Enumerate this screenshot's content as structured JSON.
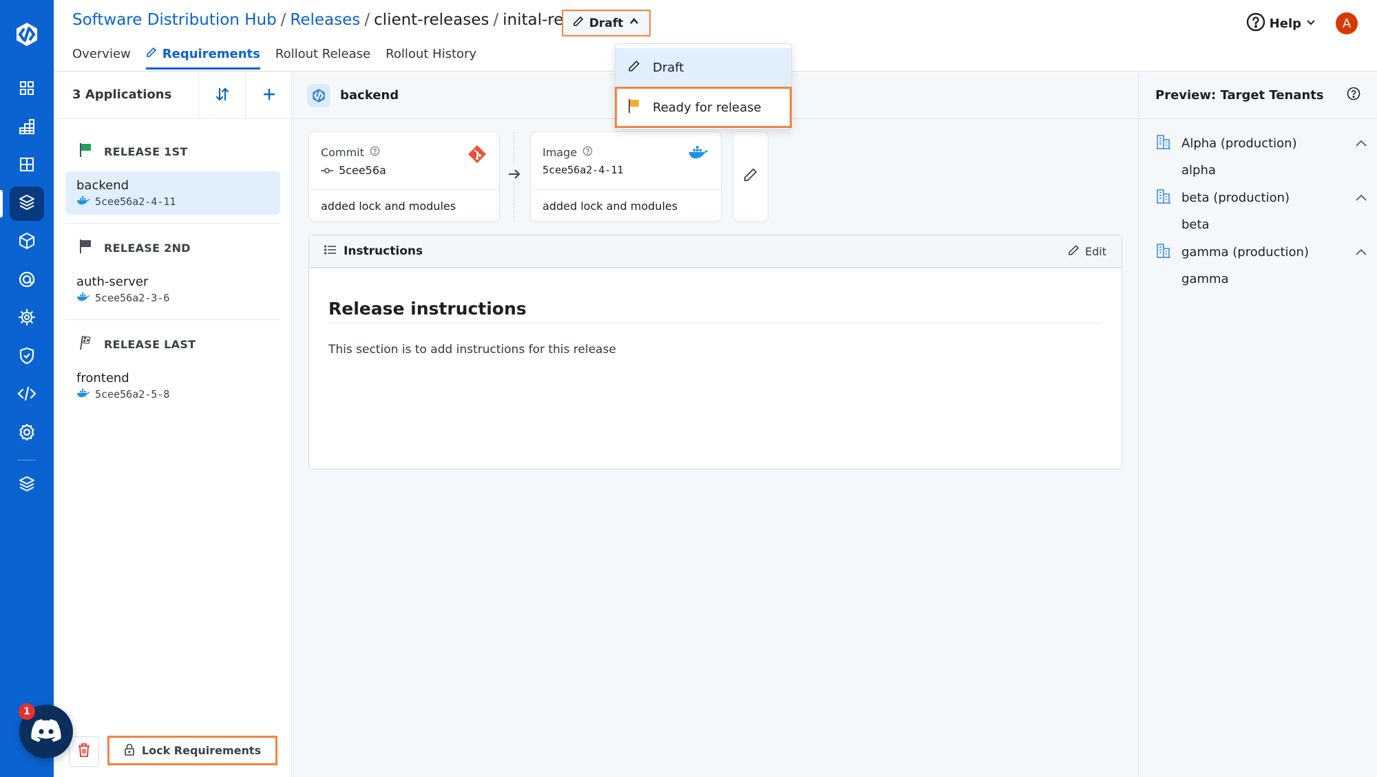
{
  "nav": {
    "logo": "app-logo",
    "items": [
      {
        "name": "dashboard",
        "icon": "grid-icon"
      },
      {
        "name": "analytics",
        "icon": "stacked-grid-icon"
      },
      {
        "name": "layout",
        "icon": "table-icon"
      },
      {
        "name": "releases",
        "icon": "box-stack-icon",
        "active": true
      },
      {
        "name": "packages",
        "icon": "cube-icon"
      },
      {
        "name": "targets",
        "icon": "at-target-icon"
      },
      {
        "name": "environments",
        "icon": "helm-wheel-icon"
      },
      {
        "name": "security",
        "icon": "shield-check-icon"
      },
      {
        "name": "developer",
        "icon": "code-icon"
      },
      {
        "name": "settings",
        "icon": "gear-icon"
      },
      {
        "name": "layers",
        "icon": "layers-icon"
      }
    ]
  },
  "header": {
    "breadcrumb": {
      "root": "Software Distribution Hub",
      "section": "Releases",
      "group": "client-releases",
      "current": "inital-release",
      "sep": "/"
    },
    "status_button": "Draft",
    "help_label": "Help",
    "avatar_initial": "A",
    "tabs": [
      {
        "label": "Overview"
      },
      {
        "label": "Requirements",
        "active": true
      },
      {
        "label": "Rollout Release"
      },
      {
        "label": "Rollout History"
      }
    ]
  },
  "status_dropdown": {
    "options": [
      {
        "label": "Draft",
        "icon": "pencil-icon",
        "current": true
      },
      {
        "label": "Ready for release",
        "icon": "flag-icon",
        "highlighted": true
      }
    ]
  },
  "left_panel": {
    "title": "3 Applications",
    "groups": [
      {
        "label": "RELEASE 1ST",
        "flag_color": "#1fa25a",
        "apps": [
          {
            "name": "backend",
            "version": "5cee56a2-4-11",
            "selected": true
          }
        ]
      },
      {
        "label": "RELEASE 2ND",
        "flag_color": "#4a5058",
        "apps": [
          {
            "name": "auth-server",
            "version": "5cee56a2-3-6"
          }
        ]
      },
      {
        "label": "RELEASE LAST",
        "flag_color": "#4a5058",
        "apps": [
          {
            "name": "frontend",
            "version": "5cee56a2-5-8"
          }
        ]
      }
    ],
    "lock_button": "Lock Requirements",
    "discord_badge": "1"
  },
  "main": {
    "app_name": "backend",
    "commit": {
      "label": "Commit",
      "value": "5cee56a",
      "message": "added lock and modules"
    },
    "image": {
      "label": "Image",
      "value": "5cee56a2-4-11",
      "message": "added lock and modules"
    },
    "instructions": {
      "title": "Instructions",
      "edit_label": "Edit",
      "heading": "Release instructions",
      "body": "This section is to add instructions for this release"
    }
  },
  "right_panel": {
    "title": "Preview: Target Tenants",
    "tenants": [
      {
        "label": "Alpha (production)",
        "sub": "alpha"
      },
      {
        "label": "beta (production)",
        "sub": "beta"
      },
      {
        "label": "gamma (production)",
        "sub": "gamma"
      }
    ]
  },
  "colors": {
    "brand": "#0a63d1",
    "highlight": "#f5823a",
    "git": "#f05133",
    "docker": "#1d91e6"
  }
}
